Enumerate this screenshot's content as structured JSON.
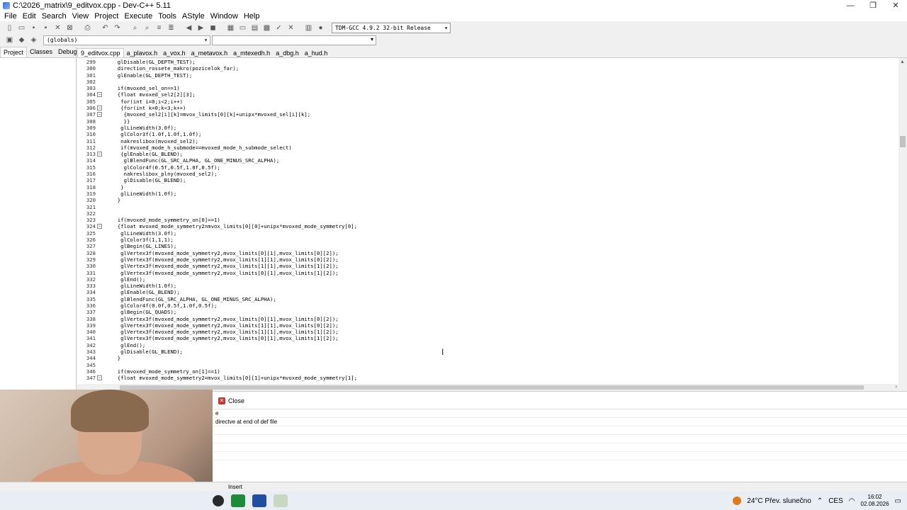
{
  "window": {
    "title": "C:\\2026_matrix\\9_editvox.cpp - Dev-C++ 5.11",
    "controls": [
      "—",
      "❐",
      "✕"
    ]
  },
  "menu": [
    "File",
    "Edit",
    "Search",
    "View",
    "Project",
    "Execute",
    "Tools",
    "AStyle",
    "Window",
    "Help"
  ],
  "toolbar": {
    "compiler": "TDM-GCC 4.9.2 32-bit Release",
    "scope": "(globals)"
  },
  "left_panel": {
    "tabs": [
      "Project",
      "Classes",
      "Debug"
    ]
  },
  "file_tabs": [
    "9_editvox.cpp",
    "a_plavox.h",
    "a_vox.h",
    "a_metavox.h",
    "a_mtexedh.h",
    "a_dbg.h",
    "a_hud.h"
  ],
  "code_lines": [
    {
      "n": "299",
      "t": "  glDisable(GL_DEPTH_TEST);",
      "f": ""
    },
    {
      "n": "300",
      "t": "  direction_rossete_makro(pozicelok_far);",
      "f": ""
    },
    {
      "n": "301",
      "t": "  glEnable(GL_DEPTH_TEST);",
      "f": ""
    },
    {
      "n": "302",
      "t": "",
      "f": ""
    },
    {
      "n": "303",
      "t": "  if(mvoxed_sel_on==1)",
      "f": ""
    },
    {
      "n": "304",
      "t": "  {float mvoxed_sel2[2][3];",
      "f": "−"
    },
    {
      "n": "305",
      "t": "   for(int i=0;i<2;i++)",
      "f": ""
    },
    {
      "n": "306",
      "t": "   {for(int k=0;k<3;k++)",
      "f": "−"
    },
    {
      "n": "307",
      "t": "    {mvoxed_sel2[i][k]=mvox_limits[0][k]+unipx*mvoxed_sel[i][k];",
      "f": "−"
    },
    {
      "n": "308",
      "t": "    }}",
      "f": ""
    },
    {
      "n": "309",
      "t": "   glLineWidth(3.0f);",
      "f": ""
    },
    {
      "n": "310",
      "t": "   glColor3f(1.0f,1.0f,1.0f);",
      "f": ""
    },
    {
      "n": "311",
      "t": "   nakreslibox(mvoxed_sel2);",
      "f": ""
    },
    {
      "n": "312",
      "t": "   if(mvoxed_mode_h_submode==mvoxed_mode_h_submode_select)",
      "f": ""
    },
    {
      "n": "313",
      "t": "   {glEnable(GL_BLEND);",
      "f": "−"
    },
    {
      "n": "314",
      "t": "    glBlendFunc(GL_SRC_ALPHA, GL_ONE_MINUS_SRC_ALPHA);",
      "f": ""
    },
    {
      "n": "315",
      "t": "    glColor4f(0.5f,0.5f,1.0f,0.5f);",
      "f": ""
    },
    {
      "n": "316",
      "t": "    nakreslibox_plny(mvoxed_sel2);",
      "f": ""
    },
    {
      "n": "317",
      "t": "    glDisable(GL_BLEND);",
      "f": ""
    },
    {
      "n": "318",
      "t": "   }",
      "f": ""
    },
    {
      "n": "319",
      "t": "   glLineWidth(1.0f);",
      "f": ""
    },
    {
      "n": "320",
      "t": "  }",
      "f": ""
    },
    {
      "n": "321",
      "t": "",
      "f": ""
    },
    {
      "n": "322",
      "t": "",
      "f": ""
    },
    {
      "n": "323",
      "t": "  if(mvoxed_mode_symmetry_on[0]==1)",
      "f": ""
    },
    {
      "n": "324",
      "t": "  {float mvoxed_mode_symmetry2=mvox_limits[0][0]+unipx*mvoxed_mode_symmetry[0];",
      "f": "−"
    },
    {
      "n": "325",
      "t": "   glLineWidth(3.0f);",
      "f": ""
    },
    {
      "n": "326",
      "t": "   glColor3f(1,1,1);",
      "f": ""
    },
    {
      "n": "327",
      "t": "   glBegin(GL_LINES);",
      "f": ""
    },
    {
      "n": "328",
      "t": "   glVertex3f(mvoxed_mode_symmetry2,mvox_limits[0][1],mvox_limits[0][2]);",
      "f": ""
    },
    {
      "n": "329",
      "t": "   glVertex3f(mvoxed_mode_symmetry2,mvox_limits[1][1],mvox_limits[0][2]);",
      "f": ""
    },
    {
      "n": "330",
      "t": "   glVertex3f(mvoxed_mode_symmetry2,mvox_limits[1][1],mvox_limits[1][2]);",
      "f": ""
    },
    {
      "n": "331",
      "t": "   glVertex3f(mvoxed_mode_symmetry2,mvox_limits[0][1],mvox_limits[1][2]);",
      "f": ""
    },
    {
      "n": "332",
      "t": "   glEnd();",
      "f": ""
    },
    {
      "n": "333",
      "t": "   glLineWidth(1.0f);",
      "f": ""
    },
    {
      "n": "334",
      "t": "   glEnable(GL_BLEND);",
      "f": ""
    },
    {
      "n": "335",
      "t": "   glBlendFunc(GL_SRC_ALPHA, GL_ONE_MINUS_SRC_ALPHA);",
      "f": ""
    },
    {
      "n": "336",
      "t": "   glColor4f(0.0f,0.5f,1.0f,0.5f);",
      "f": ""
    },
    {
      "n": "337",
      "t": "   glBegin(GL_QUADS);",
      "f": ""
    },
    {
      "n": "338",
      "t": "   glVertex3f(mvoxed_mode_symmetry2,mvox_limits[0][1],mvox_limits[0][2]);",
      "f": ""
    },
    {
      "n": "339",
      "t": "   glVertex3f(mvoxed_mode_symmetry2,mvox_limits[1][1],mvox_limits[0][2]);",
      "f": ""
    },
    {
      "n": "340",
      "t": "   glVertex3f(mvoxed_mode_symmetry2,mvox_limits[1][1],mvox_limits[1][2]);",
      "f": ""
    },
    {
      "n": "341",
      "t": "   glVertex3f(mvoxed_mode_symmetry2,mvox_limits[0][1],mvox_limits[1][2]);",
      "f": ""
    },
    {
      "n": "342",
      "t": "   glEnd();",
      "f": ""
    },
    {
      "n": "343",
      "t": "   glDisable(GL_BLEND);",
      "f": ""
    },
    {
      "n": "344",
      "t": "  }",
      "f": ""
    },
    {
      "n": "345",
      "t": "",
      "f": ""
    },
    {
      "n": "346",
      "t": "  if(mvoxed_mode_symmetry_on[1]==1)",
      "f": ""
    },
    {
      "n": "347",
      "t": "  {float mvoxed_mode_symmetry2=mvox_limits[0][1]+unipx*mvoxed_mode_symmetry[1];",
      "f": "−"
    }
  ],
  "bottom_panel": {
    "close_label": "Close",
    "messages": [
      "e",
      "directve at end of def file"
    ]
  },
  "status": {
    "mode": "Insert"
  },
  "taskbar": {
    "weather": "24°C  Přev. slunečno",
    "language": "CES",
    "time": "16:02",
    "date": "02.08.2026"
  }
}
